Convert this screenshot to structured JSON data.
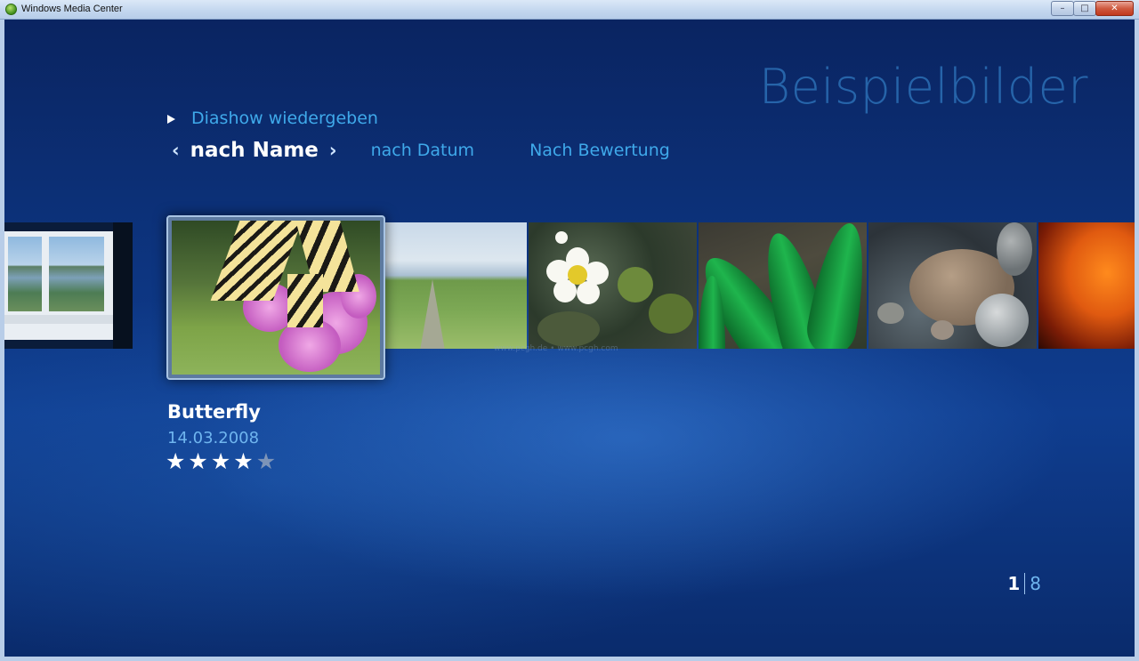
{
  "window": {
    "title": "Windows Media Center",
    "controls": {
      "minimize": "–",
      "maximize": "□",
      "close": "✕"
    }
  },
  "page": {
    "heading": "Beispielbilder"
  },
  "menu": {
    "play_label": "Diashow wiedergeben"
  },
  "sort": {
    "active": "nach Name",
    "options": [
      "nach Datum",
      "Nach Bewertung"
    ]
  },
  "selected_item": {
    "title": "Butterfly",
    "date": "14.03.2008",
    "rating": 4,
    "rating_max": 5
  },
  "watermark": "www.pcgh.de • www.pcgh.com",
  "pager": {
    "current": "1",
    "total": "8"
  }
}
